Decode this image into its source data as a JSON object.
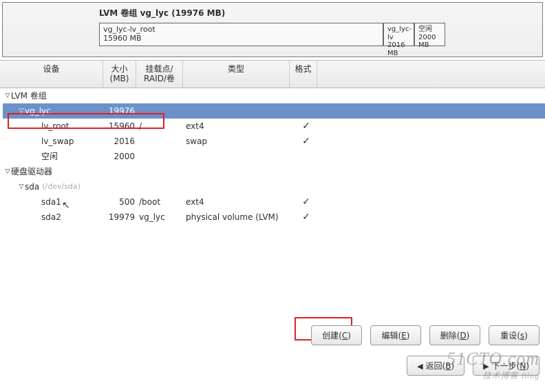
{
  "header": {
    "title": "LVM 卷组 vg_lyc (19976 MB)",
    "blocks": [
      {
        "name": "vg_lyc-lv_root",
        "size": "15960 MB"
      },
      {
        "name": "vg_lyc-lv",
        "size": "2016 MB"
      },
      {
        "name": "空闲",
        "size": "2000 MB"
      }
    ]
  },
  "columns": {
    "device": "设备",
    "size_line1": "大小",
    "size_line2": "(MB)",
    "mount_line1": "挂载点/",
    "mount_line2": "RAID/卷",
    "type": "类型",
    "format": "格式"
  },
  "tree": [
    {
      "level": 0,
      "expander": "▽",
      "device": "LVM 卷组",
      "size": "",
      "mount": "",
      "type": "",
      "fmt": "",
      "selected": false
    },
    {
      "level": 1,
      "expander": "▽",
      "device": "vg_lyc",
      "size": "19976",
      "mount": "",
      "type": "",
      "fmt": "",
      "selected": true
    },
    {
      "level": 2,
      "expander": "",
      "device": "lv_root",
      "size": "15960",
      "mount": "/",
      "type": "ext4",
      "fmt": "✓",
      "selected": false
    },
    {
      "level": 2,
      "expander": "",
      "device": "lv_swap",
      "size": "2016",
      "mount": "",
      "type": "swap",
      "fmt": "✓",
      "selected": false
    },
    {
      "level": 2,
      "expander": "",
      "device": "空闲",
      "size": "2000",
      "mount": "",
      "type": "",
      "fmt": "",
      "selected": false
    },
    {
      "level": 0,
      "expander": "▽",
      "device": "硬盘驱动器",
      "size": "",
      "mount": "",
      "type": "",
      "fmt": "",
      "selected": false
    },
    {
      "level": 1,
      "expander": "▽",
      "device": "sda",
      "devpath": "(/dev/sda)",
      "size": "",
      "mount": "",
      "type": "",
      "fmt": "",
      "selected": false
    },
    {
      "level": 2,
      "expander": "",
      "device": "sda1",
      "size": "500",
      "mount": "/boot",
      "type": "ext4",
      "fmt": "✓",
      "selected": false
    },
    {
      "level": 2,
      "expander": "",
      "device": "sda2",
      "size": "19979",
      "mount": "vg_lyc",
      "type": "physical volume (LVM)",
      "fmt": "✓",
      "selected": false
    }
  ],
  "buttons": {
    "create": "创建",
    "create_u": "C",
    "edit": "编辑",
    "edit_u": "E",
    "delete": "删除",
    "delete_u": "D",
    "reset": "重设",
    "reset_u": "s",
    "back": "返回",
    "back_u": "B",
    "next": "下一步",
    "next_u": "N"
  },
  "watermark": {
    "main": "51CTO.com",
    "sub": "技术博客 Blog"
  }
}
